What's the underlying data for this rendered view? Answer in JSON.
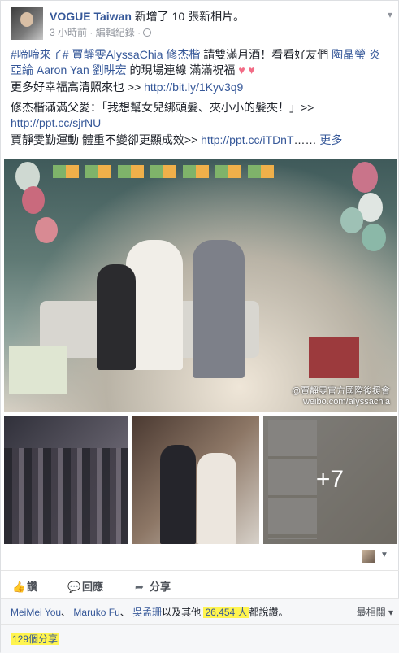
{
  "post": {
    "page_name": "VOGUE Taiwan",
    "action_text": "新增了 10 張新相片。",
    "time": "3 小時前",
    "separator": "·",
    "edit_history": "編輯紀錄",
    "line1_hashtag": "#啼啼來了#",
    "line1_tag1": "賈靜雯AlyssaChia",
    "line1_tag2": "修杰楷",
    "line1_text": " 請雙滿月酒！看看好友們",
    "line1_tag3": "陶晶瑩",
    "line2_tag1": "炎亞綸 Aaron Yan",
    "line2_tag2": "劉畊宏",
    "line2_text": " 的現場連線 滿滿祝福",
    "hearts": "♥ ♥",
    "line3_text": "更多好幸福高清照來也 >> ",
    "line3_link": "http://bit.ly/1Kyv3q9",
    "line4_text": "修杰楷滿滿父愛：「我想幫女兒綁頭髮、夾小小的髮夾！」>>",
    "line4_link": "http://ppt.cc/sjrNU",
    "line5_text": "賈靜雯勤運動 體重不變卻更顯成效>> ",
    "line5_link": "http://ppt.cc/iTDnT",
    "ellipsis": "……",
    "see_more": "更多"
  },
  "photos": {
    "watermark_line1": "@賈靜雯官方國際後援會",
    "watermark_line2": "weibo.com/alyssachia",
    "more_count": "+7"
  },
  "actions": {
    "like": "讚",
    "comment": "回應",
    "share": "分享"
  },
  "likes": {
    "name1": "MeiMei You",
    "sep1": "、",
    "name2": "Maruko Fu",
    "sep2": "、",
    "name3": "吳孟珊",
    "middle": "以及其他 ",
    "count": "26,454 人",
    "suffix": "都說讚。",
    "sort": "最相關 ▾"
  },
  "shares": {
    "count": "129個分享"
  },
  "colors": {
    "link": "#365899",
    "highlight": "#fff44f",
    "bg": "#e9ebee"
  }
}
